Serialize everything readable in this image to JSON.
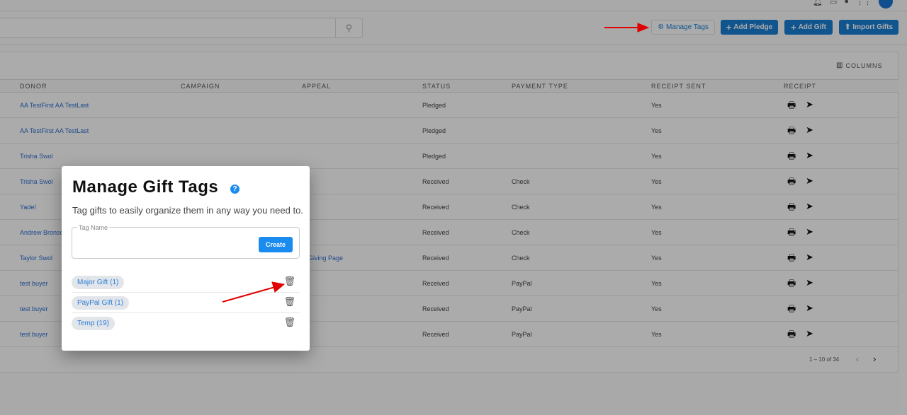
{
  "header": {
    "avatar_initial": "",
    "search_icon": "search-icon"
  },
  "toolbar": {
    "manage_tags": "Manage Tags",
    "add_pledge": "Add Pledge",
    "add_gift": "Add Gift",
    "import_gifts": "Import Gifts"
  },
  "table": {
    "columns_label": "COLUMNS",
    "headers": [
      "DONOR",
      "CAMPAIGN",
      "APPEAL",
      "STATUS",
      "PAYMENT TYPE",
      "RECEIPT SENT",
      "RECEIPT"
    ],
    "rows": [
      {
        "donor": "AA TestFirst AA TestLast",
        "appeal": "",
        "status": "Pledged",
        "payment": "",
        "receipt_sent": "Yes"
      },
      {
        "donor": "AA TestFirst AA TestLast",
        "appeal": "",
        "status": "Pledged",
        "payment": "",
        "receipt_sent": "Yes"
      },
      {
        "donor": "Trisha Swol",
        "appeal": "",
        "status": "Pledged",
        "payment": "",
        "receipt_sent": "Yes"
      },
      {
        "donor": "Trisha Swol",
        "appeal": "",
        "status": "Received",
        "payment": "Check",
        "receipt_sent": "Yes"
      },
      {
        "donor": "Yadel",
        "appeal": "",
        "status": "Received",
        "payment": "Check",
        "receipt_sent": "Yes"
      },
      {
        "donor": "Andrew Bronso",
        "appeal": "",
        "status": "Received",
        "payment": "Check",
        "receipt_sent": "Yes"
      },
      {
        "donor": "Taylor Swol",
        "appeal": "w Giving Page",
        "status": "Received",
        "payment": "Check",
        "receipt_sent": "Yes"
      },
      {
        "donor": "test buyer",
        "appeal": "",
        "status": "Received",
        "payment": "PayPal",
        "receipt_sent": "Yes"
      },
      {
        "donor": "test buyer",
        "appeal": "",
        "status": "Received",
        "payment": "PayPal",
        "receipt_sent": "Yes"
      },
      {
        "donor": "test buyer",
        "appeal": "",
        "status": "Received",
        "payment": "PayPal",
        "receipt_sent": "Yes"
      }
    ],
    "pagination": "1 – 10 of 34"
  },
  "modal": {
    "title": "Manage Gift Tags",
    "help": "?",
    "subtitle": "Tag gifts to easily organize them in any way you need to.",
    "field_label": "Tag Name",
    "field_value": "",
    "create": "Create",
    "tags": [
      "Major Gift (1)",
      "PayPal Gift (1)",
      "Temp (19)"
    ]
  },
  "colors": {
    "primary": "#1a7fd6",
    "annotation_arrow": "#e00000"
  }
}
